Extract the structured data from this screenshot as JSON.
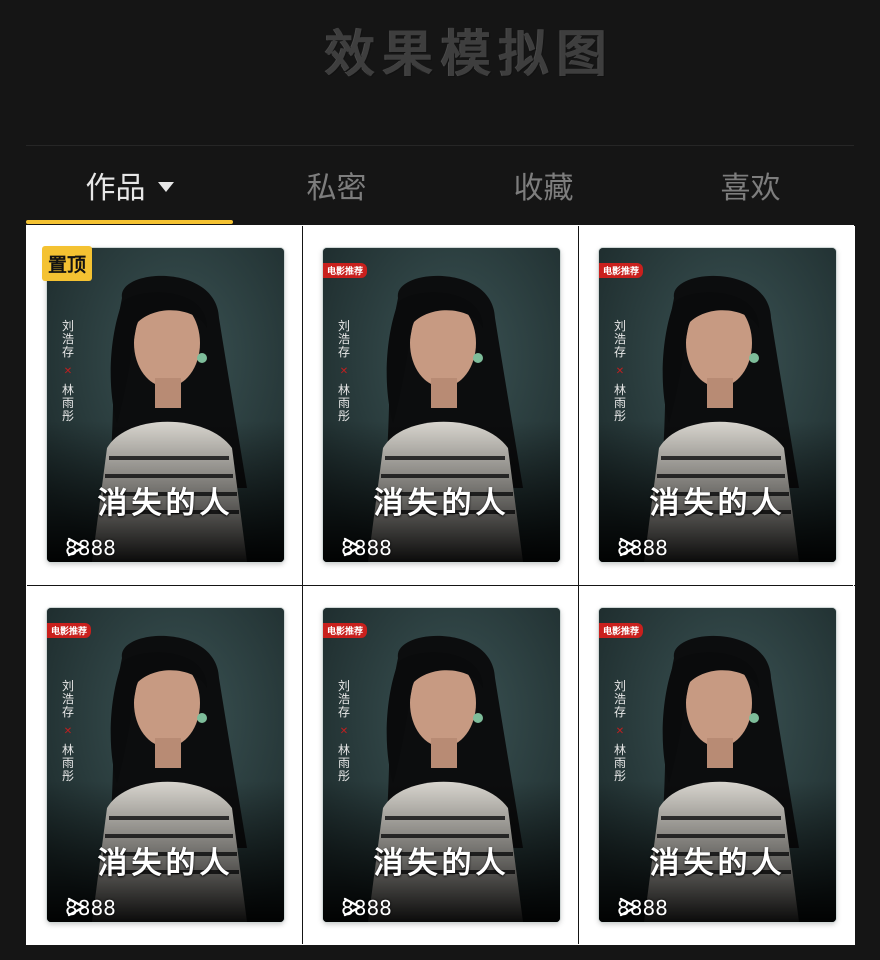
{
  "header": {
    "title": "效果模拟图"
  },
  "tabs": [
    {
      "label": "作品",
      "active": true
    },
    {
      "label": "私密",
      "active": false
    },
    {
      "label": "收藏",
      "active": false
    },
    {
      "label": "喜欢",
      "active": false
    }
  ],
  "accent_color": "#f4c232",
  "videos": [
    {
      "title": "消失的人",
      "credit_1": "刘浩存",
      "credit_2": "林雨彤",
      "views": "8888",
      "pinned": true,
      "pin_label": "置顶",
      "logo_text": ""
    },
    {
      "title": "消失的人",
      "credit_1": "刘浩存",
      "credit_2": "林雨彤",
      "views": "8888",
      "pinned": false,
      "pin_label": "",
      "logo_text": "电影推荐"
    },
    {
      "title": "消失的人",
      "credit_1": "刘浩存",
      "credit_2": "林雨彤",
      "views": "8888",
      "pinned": false,
      "pin_label": "",
      "logo_text": "电影推荐"
    },
    {
      "title": "消失的人",
      "credit_1": "刘浩存",
      "credit_2": "林雨彤",
      "views": "8888",
      "pinned": false,
      "pin_label": "",
      "logo_text": "电影推荐"
    },
    {
      "title": "消失的人",
      "credit_1": "刘浩存",
      "credit_2": "林雨彤",
      "views": "8888",
      "pinned": false,
      "pin_label": "",
      "logo_text": "电影推荐"
    },
    {
      "title": "消失的人",
      "credit_1": "刘浩存",
      "credit_2": "林雨彤",
      "views": "8888",
      "pinned": false,
      "pin_label": "",
      "logo_text": "电影推荐"
    }
  ]
}
